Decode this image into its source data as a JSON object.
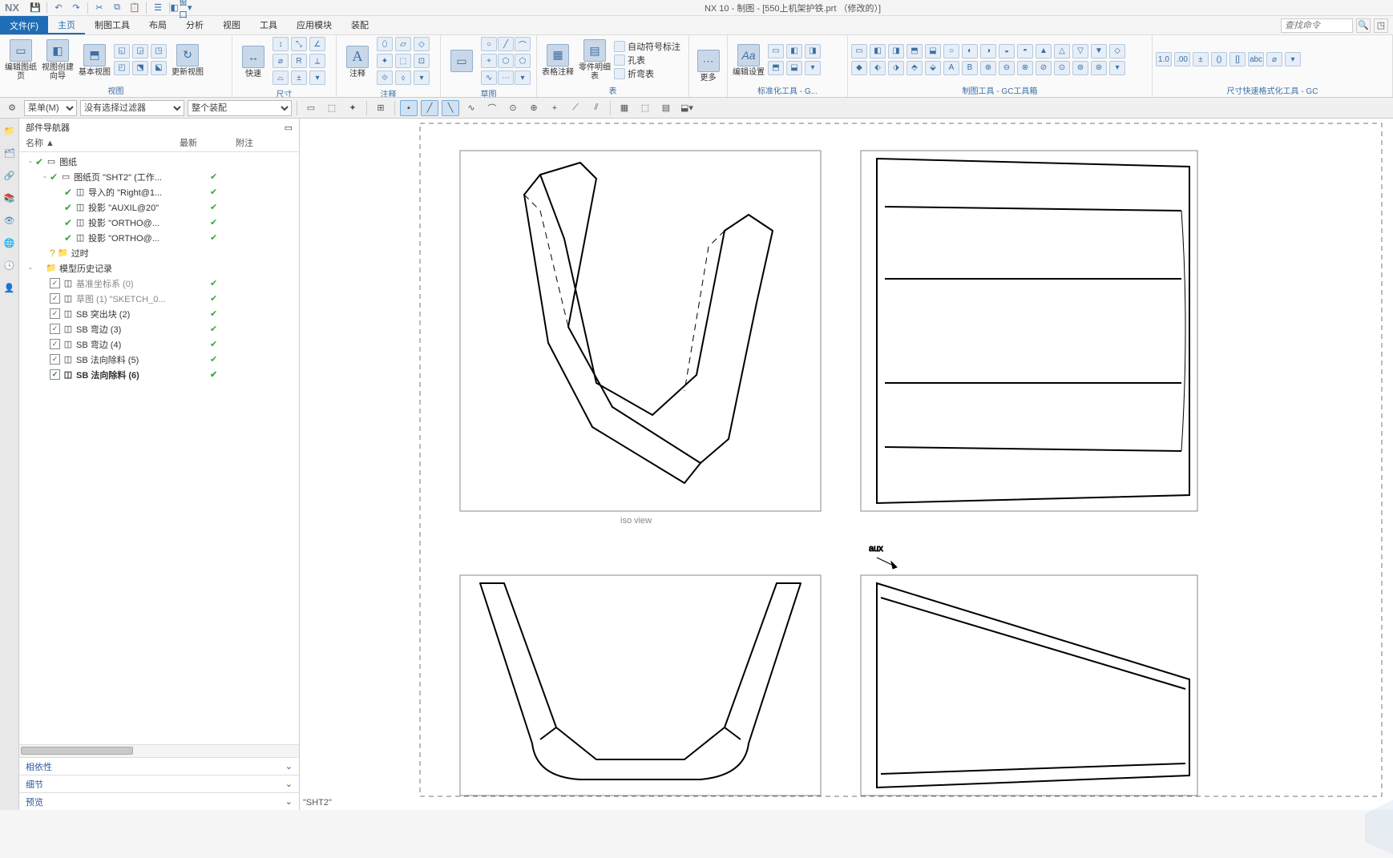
{
  "app": {
    "name": "NX",
    "title": "NX 10 - 制图 - [550上机架护铁.prt （修改的）]"
  },
  "qat": [
    "save-icon",
    "undo-icon",
    "redo-icon",
    "cut-icon",
    "copy-icon",
    "paste-icon",
    "touch-icon",
    "window-icon"
  ],
  "qat_window_label": "窗口",
  "menu": {
    "file": "文件(F)",
    "tabs": [
      "主页",
      "制图工具",
      "布局",
      "分析",
      "视图",
      "工具",
      "应用模块",
      "装配"
    ],
    "active": 0,
    "search_placeholder": "查找命令"
  },
  "ribbon_groups": [
    {
      "label": "视图",
      "big": [
        {
          "l": "编辑图纸页"
        },
        {
          "l": "视图创建向导"
        },
        {
          "l": "基本视图"
        },
        {
          "l": "更新视图"
        }
      ],
      "grid": 6
    },
    {
      "label": "尺寸",
      "big": [
        {
          "l": "快速"
        }
      ],
      "grid": 9
    },
    {
      "label": "注释",
      "big": [
        {
          "l": "注释",
          "glyph": "A"
        }
      ],
      "grid": 9
    },
    {
      "label": "草图",
      "big": [
        {
          "l": ""
        }
      ],
      "grid": 12
    },
    {
      "label": "表",
      "big": [
        {
          "l": "表格注释"
        },
        {
          "l": "零件明细表"
        }
      ],
      "lines": [
        "自动符号标注",
        "孔表",
        "折弯表"
      ]
    },
    {
      "label": "",
      "big": [
        {
          "l": "更多"
        }
      ],
      "grid": 0
    },
    {
      "label": "标准化工具 - G...",
      "big": [
        {
          "l": "编辑设置",
          "glyph": "Aa"
        }
      ],
      "grid": 9
    },
    {
      "label": "制图工具 - GC工具箱",
      "big": [],
      "grid": 30
    },
    {
      "label": "尺寸快速格式化工具 - GC",
      "big": [],
      "grid": 10
    }
  ],
  "toolbar2": {
    "menu_label": "菜单(M)",
    "filter_label": "没有选择过滤器",
    "assembly_label": "整个装配"
  },
  "navigator": {
    "title": "部件导航器",
    "headers": [
      "名称 ▲",
      "最新",
      "附注"
    ],
    "tree": [
      {
        "d": 0,
        "exp": "-",
        "tick": true,
        "ico": "sheet-icon",
        "label": "图纸"
      },
      {
        "d": 1,
        "exp": "-",
        "tick": true,
        "ico": "page-icon",
        "label": "图纸页 \"SHT2\" (工作...",
        "latest": true
      },
      {
        "d": 2,
        "exp": "",
        "tick": true,
        "ico": "import-icon",
        "label": "导入的 \"Right@1...",
        "latest": true
      },
      {
        "d": 2,
        "exp": "",
        "tick": true,
        "ico": "proj-icon",
        "label": "投影 \"AUXIL@20\"",
        "latest": true
      },
      {
        "d": 2,
        "exp": "",
        "tick": true,
        "ico": "ortho-icon",
        "label": "投影 \"ORTHO@...",
        "latest": true
      },
      {
        "d": 2,
        "exp": "",
        "tick": true,
        "ico": "ortho-icon",
        "label": "投影 \"ORTHO@...",
        "latest": true
      },
      {
        "d": 1,
        "exp": "",
        "q": true,
        "ico": "folder-icon",
        "label": "过时"
      },
      {
        "d": 0,
        "exp": "-",
        "folder": true,
        "ico": "folder-icon",
        "label": "模型历史记录"
      },
      {
        "d": 1,
        "chk": true,
        "ico": "csys-icon",
        "label": "基准坐标系 (0)",
        "gray": true,
        "latest": true
      },
      {
        "d": 1,
        "chk": true,
        "ico": "sketch-icon",
        "label": "草图 (1) \"SKETCH_0...",
        "gray": true,
        "latest": true
      },
      {
        "d": 1,
        "chk": true,
        "ico": "sb-icon",
        "label": "SB 突出块 (2)",
        "latest": true
      },
      {
        "d": 1,
        "chk": true,
        "ico": "sb-icon",
        "label": "SB 弯边 (3)",
        "latest": true
      },
      {
        "d": 1,
        "chk": true,
        "ico": "sb-icon",
        "label": "SB 弯边 (4)",
        "latest": true
      },
      {
        "d": 1,
        "chk": true,
        "ico": "sb-icon",
        "label": "SB 法向除料 (5)",
        "latest": true
      },
      {
        "d": 1,
        "chk": true,
        "ico": "sb-icon",
        "label": "SB 法向除料 (6)",
        "bold": true,
        "latest": true
      }
    ],
    "accordions": [
      "相依性",
      "细节",
      "预览"
    ]
  },
  "status_text": "\"SHT2\"",
  "iso_label": "iso view",
  "aux_label": "aux"
}
